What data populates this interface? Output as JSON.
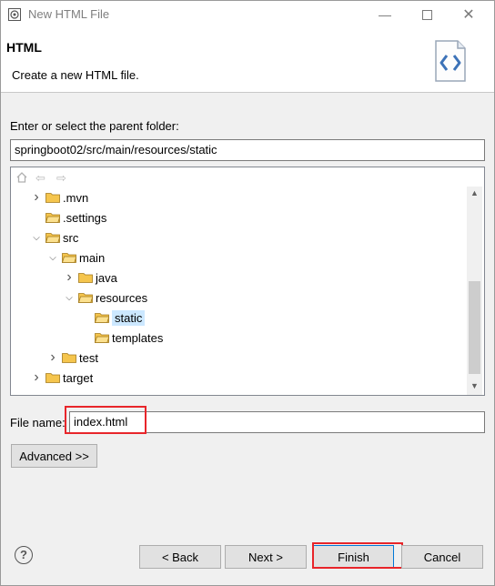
{
  "window": {
    "title": "New HTML File"
  },
  "header": {
    "title": "HTML",
    "description": "Create a new HTML file."
  },
  "folder_prompt": "Enter or select the parent folder:",
  "folder_path": "springboot02/src/main/resources/static",
  "tree": [
    {
      "label": ".mvn",
      "level": 0,
      "state": "collapsed"
    },
    {
      "label": ".settings",
      "level": 0,
      "state": "leaf"
    },
    {
      "label": "src",
      "level": 0,
      "state": "expanded"
    },
    {
      "label": "main",
      "level": 1,
      "state": "expanded"
    },
    {
      "label": "java",
      "level": 2,
      "state": "collapsed"
    },
    {
      "label": "resources",
      "level": 2,
      "state": "expanded"
    },
    {
      "label": "static",
      "level": 3,
      "state": "leaf",
      "selected": true
    },
    {
      "label": "templates",
      "level": 3,
      "state": "leaf"
    },
    {
      "label": "test",
      "level": 1,
      "state": "collapsed"
    },
    {
      "label": "target",
      "level": 0,
      "state": "collapsed"
    }
  ],
  "file_name": {
    "label": "File name:",
    "value": "index.html"
  },
  "advanced_label": "Advanced >>",
  "buttons": {
    "back": "< Back",
    "next": "Next >",
    "finish": "Finish",
    "cancel": "Cancel"
  },
  "colors": {
    "highlight": "#e8252a",
    "folder": "#f5c54d",
    "selection": "#cce8ff",
    "accent": "#0078d7"
  }
}
